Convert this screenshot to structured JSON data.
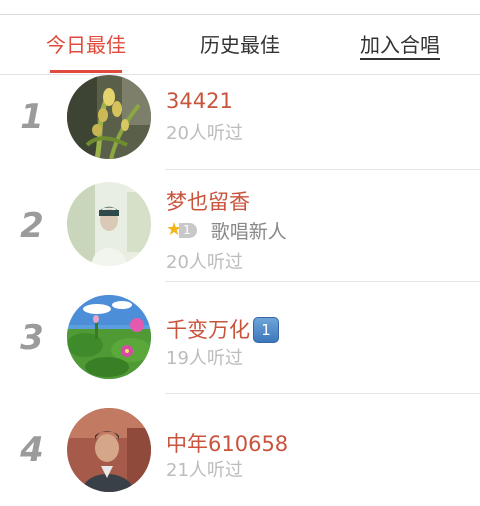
{
  "tabs": [
    {
      "label": "今日最佳",
      "active": true
    },
    {
      "label": "历史最佳",
      "active": false
    },
    {
      "label": "加入合唱",
      "active": false
    }
  ],
  "items": [
    {
      "rank": "1",
      "name": "34421",
      "listeners": "20人听过",
      "badge": ""
    },
    {
      "rank": "2",
      "name": "梦也留香",
      "listeners": "20人听过",
      "level": "1",
      "level_title": "歌唱新人"
    },
    {
      "rank": "3",
      "name": "千变万化",
      "listeners": "19人听过",
      "badge": "1"
    },
    {
      "rank": "4",
      "name": "中年610658",
      "listeners": "21人听过"
    }
  ],
  "colors": {
    "accent": "#e14b3b",
    "name": "#c9543c",
    "muted": "#bcbcbc"
  }
}
